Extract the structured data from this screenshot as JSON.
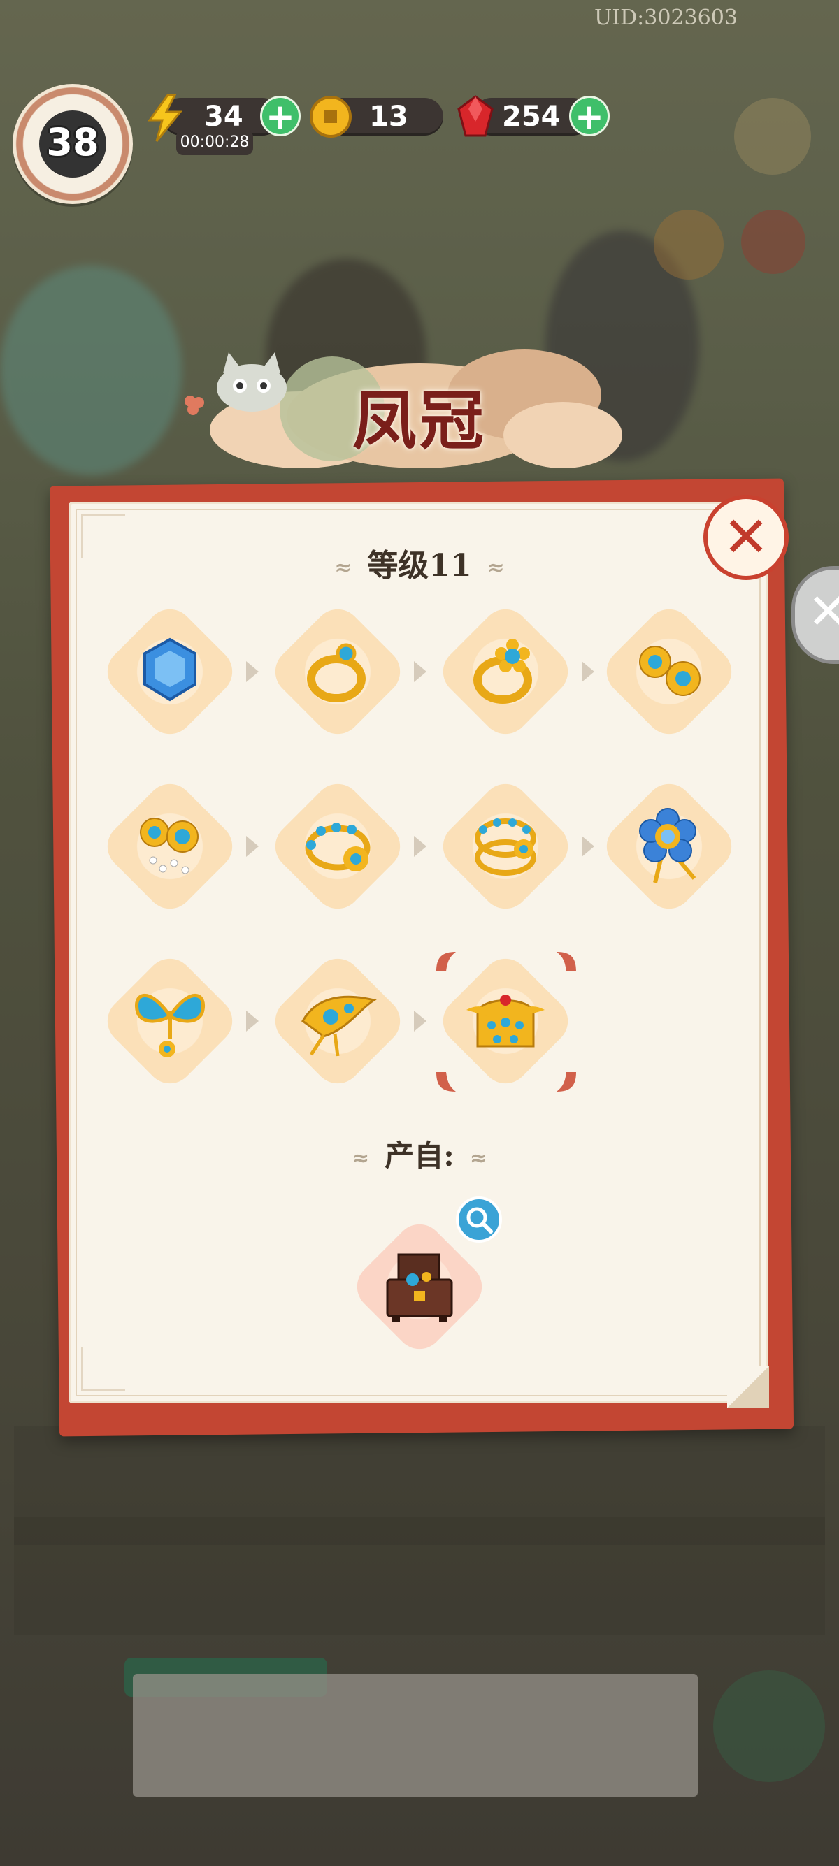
{
  "header": {
    "uid": "UID:3023603",
    "player_level": "38",
    "energy": "34",
    "energy_timer": "00:00:28",
    "coins": "13",
    "gems": "254"
  },
  "popup": {
    "title": "凤冠",
    "level_label": "等级11",
    "source_label": "产自:"
  },
  "merge_chain": [
    {
      "name": "sapphire-gem"
    },
    {
      "name": "gold-ring"
    },
    {
      "name": "gold-ring-turquoise"
    },
    {
      "name": "flower-earrings"
    },
    {
      "name": "drop-earrings"
    },
    {
      "name": "beaded-bracelet"
    },
    {
      "name": "ornate-bracelet"
    },
    {
      "name": "blue-flower-hairpin"
    },
    {
      "name": "butterfly-hairpin"
    },
    {
      "name": "golden-hair-ornament"
    },
    {
      "name": "phoenix-crown"
    }
  ],
  "colors": {
    "panel_red": "#c34633",
    "panel_paper": "#f9f4ea",
    "slot_peach": "#fbe0b8",
    "title_red": "#7a1f1a",
    "gold": "#f2b51e",
    "turquoise": "#2ea8d8"
  }
}
